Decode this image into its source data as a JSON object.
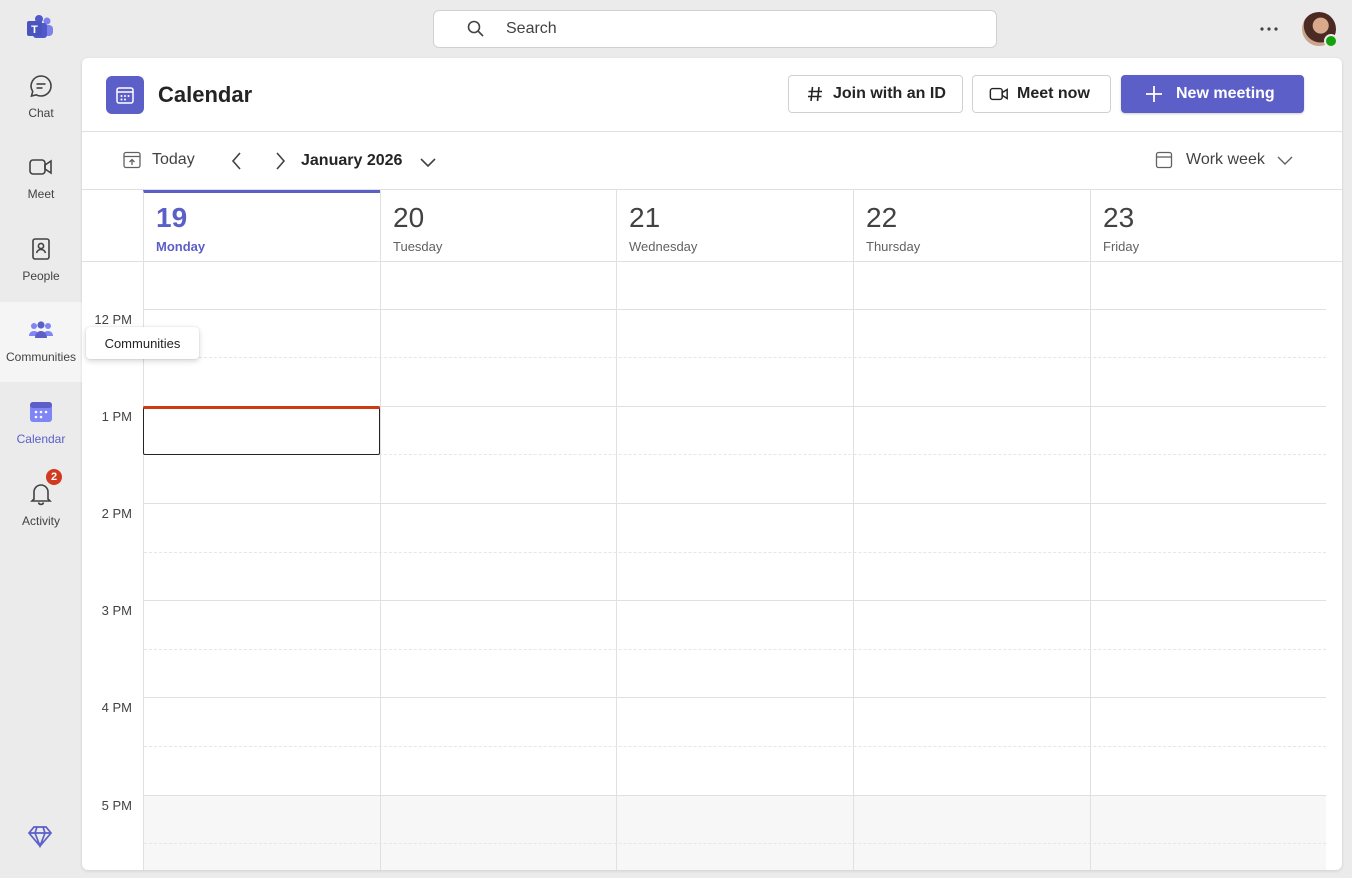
{
  "rail": {
    "items": [
      {
        "label": "Chat",
        "icon": "chat-icon"
      },
      {
        "label": "Meet",
        "icon": "video-icon"
      },
      {
        "label": "People",
        "icon": "people-book-icon"
      },
      {
        "label": "Communities",
        "icon": "communities-icon"
      },
      {
        "label": "Calendar",
        "icon": "calendar-icon"
      },
      {
        "label": "Activity",
        "icon": "bell-icon",
        "badge": "2"
      }
    ],
    "active": "Calendar",
    "hovered": "Communities"
  },
  "search": {
    "placeholder": "Search"
  },
  "tooltip": {
    "text": "Communities"
  },
  "header": {
    "title": "Calendar",
    "join_label": "Join with an ID",
    "meet_now_label": "Meet now",
    "new_meeting_label": "New meeting"
  },
  "toolbar": {
    "today_label": "Today",
    "month_label": "January 2026",
    "view_label": "Work week"
  },
  "days": [
    {
      "num": "19",
      "name": "Monday",
      "today": true
    },
    {
      "num": "20",
      "name": "Tuesday"
    },
    {
      "num": "21",
      "name": "Wednesday"
    },
    {
      "num": "22",
      "name": "Thursday"
    },
    {
      "num": "23",
      "name": "Friday"
    }
  ],
  "times": [
    "12 PM",
    "1 PM",
    "2 PM",
    "3 PM",
    "4 PM",
    "5 PM"
  ],
  "colors": {
    "accent": "#5b5fc7",
    "now": "#cc3a16",
    "badge": "#d13a1f",
    "presence": "#13a10e"
  }
}
